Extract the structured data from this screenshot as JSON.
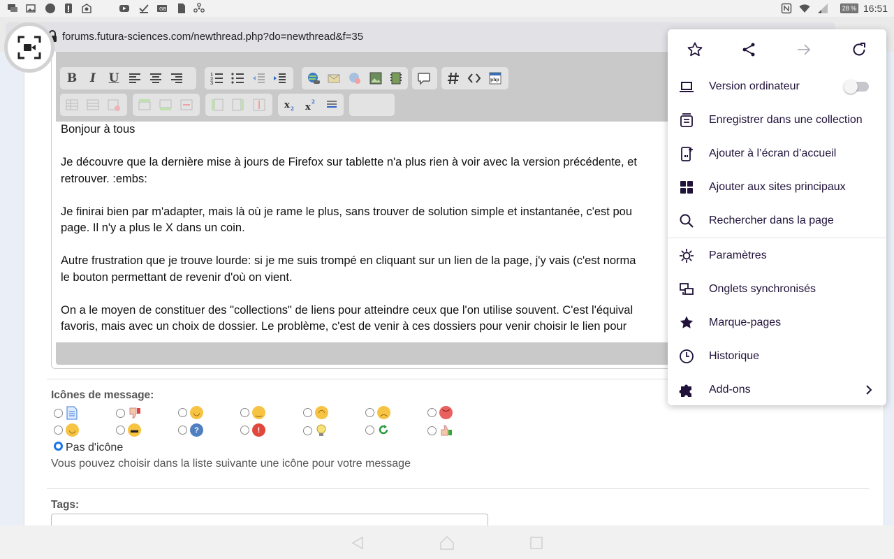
{
  "status_bar": {
    "time": "16:51",
    "battery": "28 %"
  },
  "browser": {
    "url": "forums.futura-sciences.com/newthread.php?do=newthread&f=35"
  },
  "editor": {
    "paragraphs": [
      [
        "Bonjour à tous"
      ],
      [
        "Je découvre que la dernière mise à jours de Firefox sur tablette n'a plus rien à voir avec la version précédente, et",
        "retrouver. :embs:"
      ],
      [
        "Je finirai bien par m'adapter, mais là où je rame le plus, sans trouver de solution simple et instantanée, c'est pou",
        "page. Il n'y a plus le X dans un coin."
      ],
      [
        "Autre frustration que je trouve lourde: si je me suis trompé en cliquant sur un lien de la page, j'y vais (c'est norma",
        "le bouton permettant de revenir d'où on vient."
      ],
      [
        "On a le moyen de constituer des \"collections\" de liens pour atteindre ceux que l'on utilise souvent. C'est l'équival",
        "favoris, mais avec un choix de dossier.  Le problème, c'est de venir à  ces dossiers pour venir choisir le lien pour"
      ]
    ]
  },
  "message_icons": {
    "label": "Icônes de message:",
    "no_icon_label": "Pas d'icône",
    "hint": "Vous pouvez choisir dans la liste suivante une icône pour votre message",
    "selected": "no-icon"
  },
  "tags": {
    "label": "Tags:",
    "value": ""
  },
  "menu": {
    "items": [
      {
        "label": "Version ordinateur",
        "icon": "laptop-icon"
      },
      {
        "label": "Enregistrer dans une collection",
        "icon": "collection-icon"
      },
      {
        "label": "Ajouter à l’écran d’accueil",
        "icon": "add-home-icon"
      },
      {
        "label": "Ajouter aux sites principaux",
        "icon": "grid-icon"
      },
      {
        "label": "Rechercher dans la page",
        "icon": "search-icon"
      },
      {
        "label": "Paramètres",
        "icon": "gear-icon"
      },
      {
        "label": "Onglets synchronisés",
        "icon": "synced-tabs-icon"
      },
      {
        "label": "Marque-pages",
        "icon": "star-filled-icon"
      },
      {
        "label": "Historique",
        "icon": "clock-icon"
      },
      {
        "label": "Add-ons",
        "icon": "puzzle-icon"
      }
    ],
    "desktop_toggle_on": false
  },
  "colors": {
    "menu_text": "#20123a",
    "radio_selected": "#1a73e8",
    "toolbar_bg": "#c9c9c9"
  }
}
